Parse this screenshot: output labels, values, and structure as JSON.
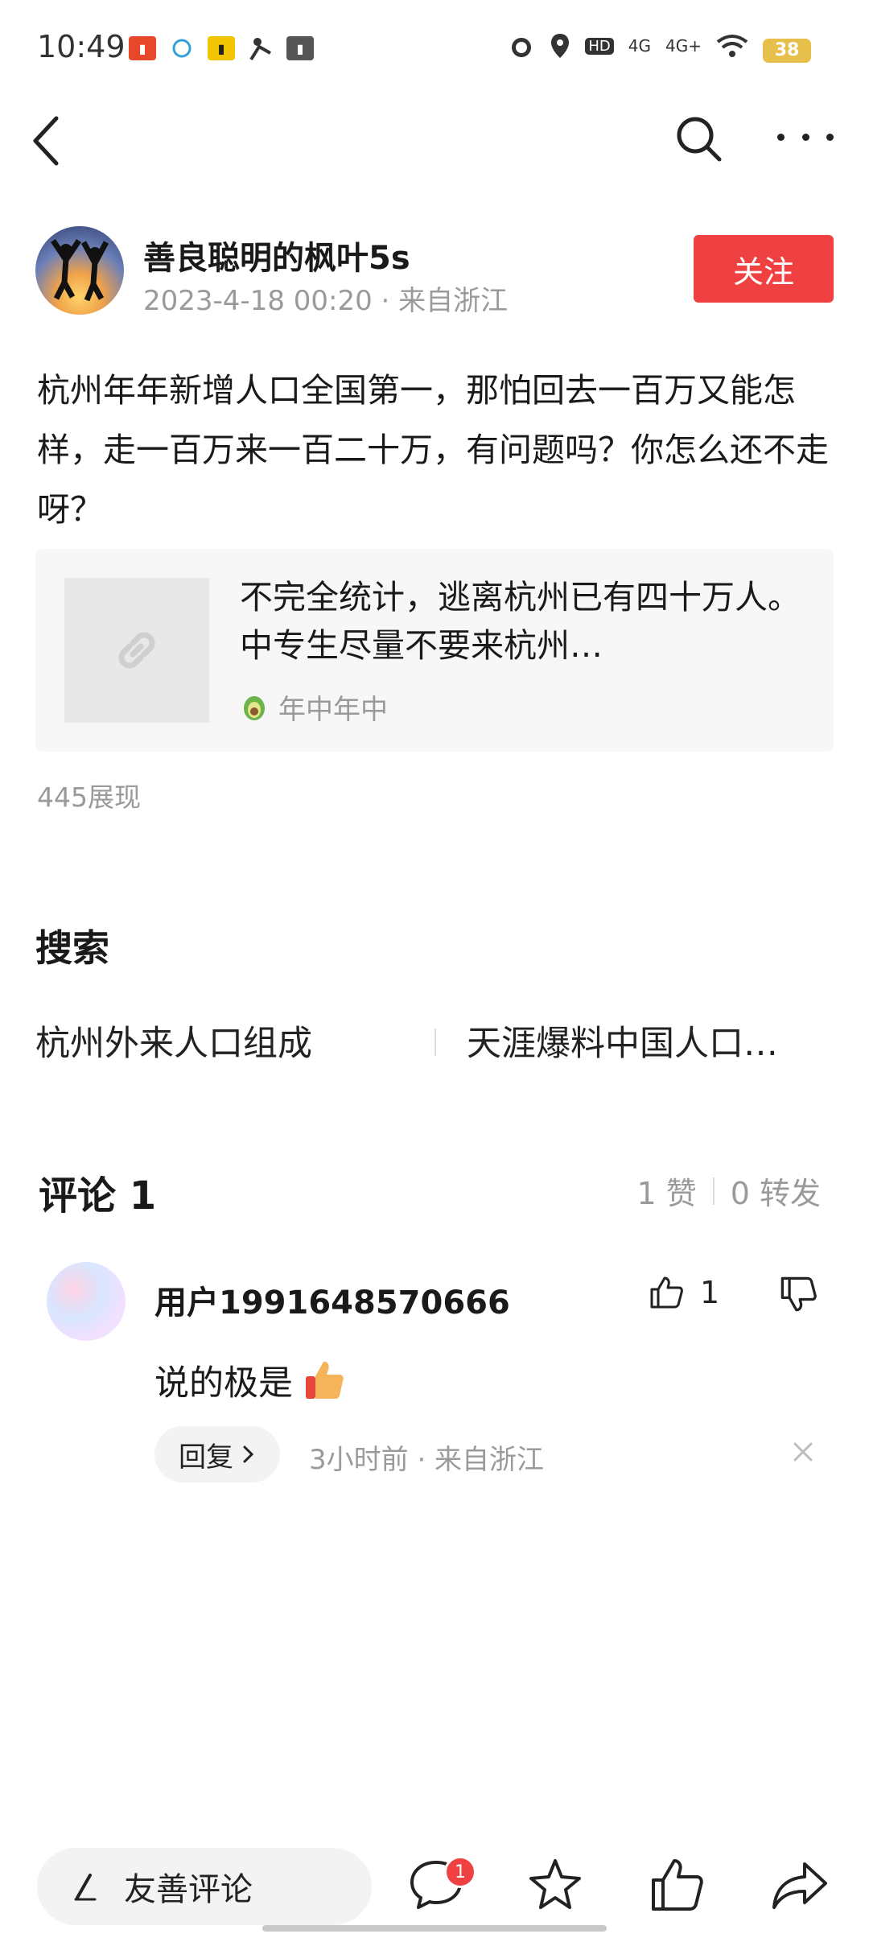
{
  "status_bar": {
    "time": "10:49",
    "battery": "38",
    "net1": "4G",
    "net2": "4G+"
  },
  "author": {
    "name": "善良聪明的枫叶5s",
    "meta": "2023-4-18 00:20 · 来自浙江",
    "follow_label": "关注"
  },
  "post": {
    "text": "杭州年年新增人口全国第一，那怕回去一百万又能怎样，走一百万来一百二十万，有问题吗？你怎么还不走呀？",
    "link_title": "不完全统计，逃离杭州已有四十万人。中专生尽量不要来杭州…",
    "link_source": "年中年中",
    "views": "445展现"
  },
  "search": {
    "heading": "搜索",
    "suggestions": [
      "杭州外来人口组成",
      "天涯爆料中国人口…"
    ]
  },
  "comments": {
    "heading": "评论 1",
    "likes": "1 赞",
    "shares": "0 转发",
    "items": [
      {
        "user": "用户1991648570666",
        "text": "说的极是",
        "like_count": "1",
        "reply_label": "回复",
        "meta": "3小时前 · 来自浙江"
      }
    ]
  },
  "bottom_bar": {
    "input_placeholder": "友善评论",
    "comment_badge": "1"
  },
  "colors": {
    "accent": "#f04142",
    "muted": "#9a9a9a"
  }
}
